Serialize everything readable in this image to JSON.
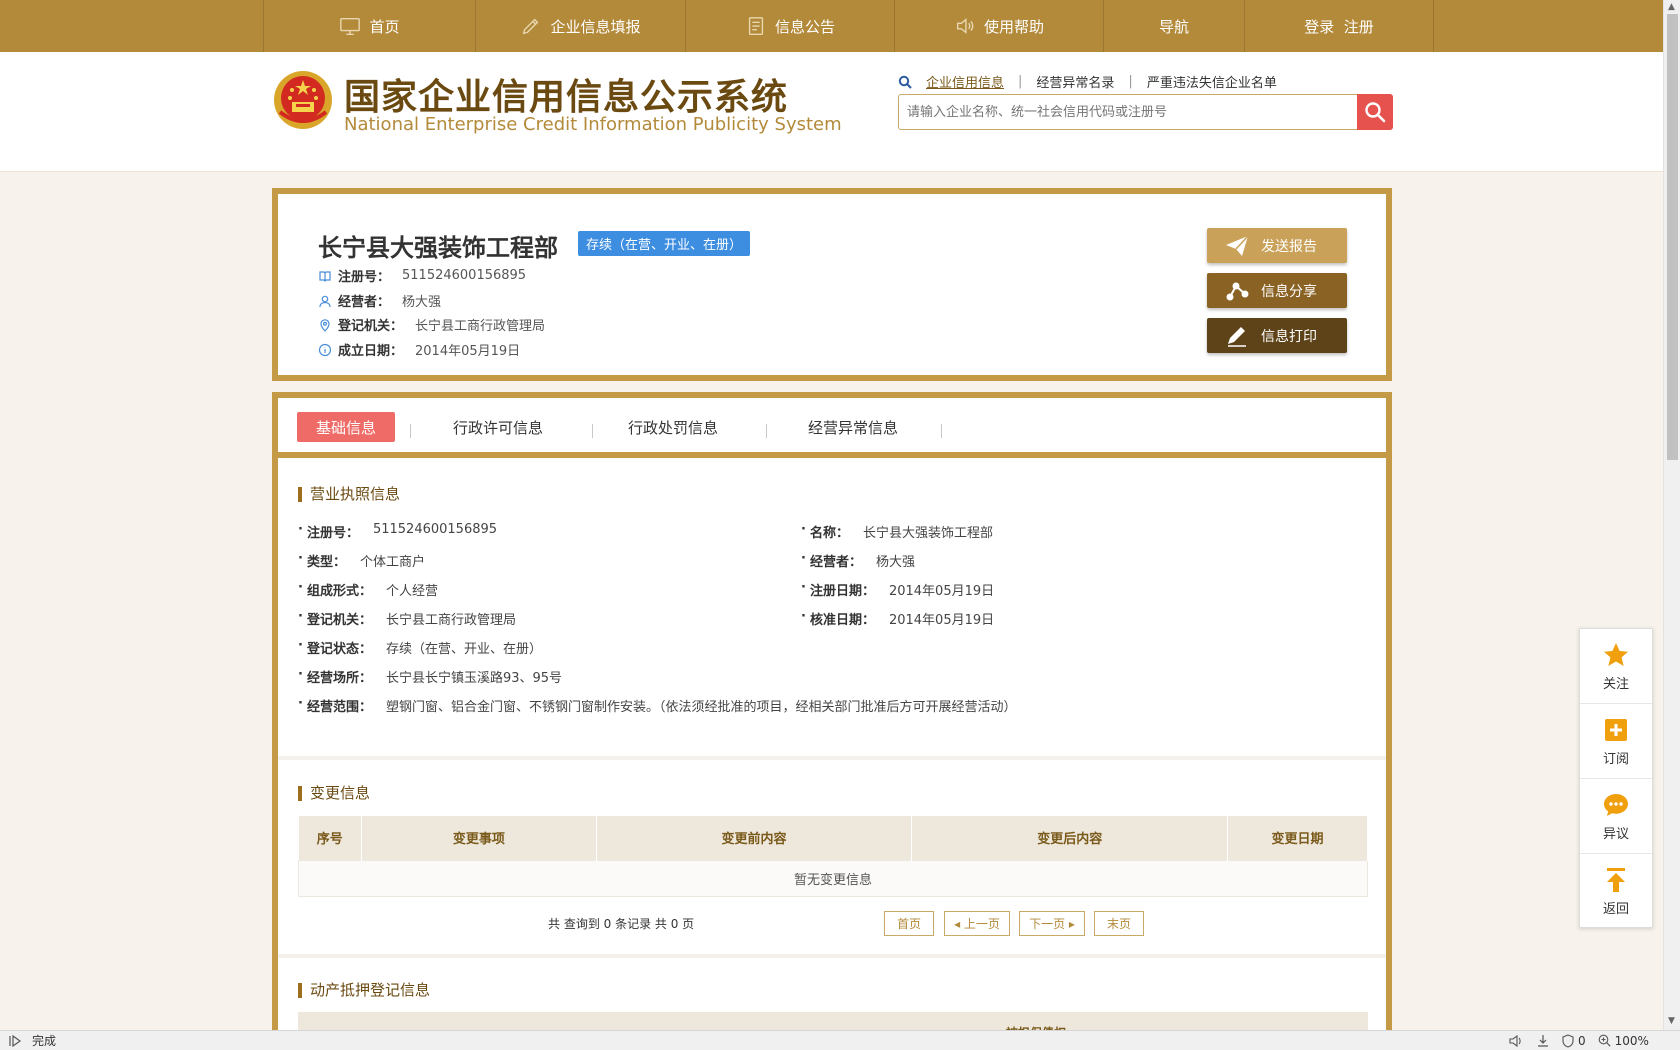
{
  "nav": {
    "items": [
      {
        "label": "首页",
        "icon": "monitor-icon"
      },
      {
        "label": "企业信息填报",
        "icon": "pen-icon"
      },
      {
        "label": "信息公告",
        "icon": "document-icon"
      },
      {
        "label": "使用帮助",
        "icon": "speaker-icon"
      },
      {
        "label": "导航",
        "icon": ""
      },
      {
        "label": "登录  注册",
        "icon": ""
      }
    ]
  },
  "header": {
    "title_cn": "国家企业信用信息公示系统",
    "title_en": "National Enterprise Credit Information Publicity System",
    "search_links": [
      "企业信用信息",
      "经营异常名录",
      "严重违法失信企业名单"
    ],
    "search_placeholder": "请输入企业名称、统一社会信用代码或注册号"
  },
  "company": {
    "name": "长宁县大强装饰工程部",
    "status": "存续（在营、开业、在册）",
    "reg_no_label": "注册号：",
    "reg_no": "511524600156895",
    "operator_label": "经营者：",
    "operator": "杨大强",
    "authority_label": "登记机关：",
    "authority": "长宁县工商行政管理局",
    "founded_label": "成立日期：",
    "founded": "2014年05月19日",
    "actions": [
      "发送报告",
      "信息分享",
      "信息打印"
    ]
  },
  "tabs": [
    "基础信息",
    "行政许可信息",
    "行政处罚信息",
    "经营异常信息"
  ],
  "license": {
    "title": "营业执照信息",
    "left": [
      {
        "label": "注册号：",
        "value": "511524600156895"
      },
      {
        "label": "类型：",
        "value": "个体工商户"
      },
      {
        "label": "组成形式：",
        "value": "个人经营"
      },
      {
        "label": "登记机关：",
        "value": "长宁县工商行政管理局"
      },
      {
        "label": "登记状态：",
        "value": "存续（在营、开业、在册）"
      },
      {
        "label": "经营场所：",
        "value": "长宁县长宁镇玉溪路93、95号"
      },
      {
        "label": "经营范围：",
        "value": "塑钢门窗、铝合金门窗、不锈钢门窗制作安装。（依法须经批准的项目，经相关部门批准后方可开展经营活动）"
      }
    ],
    "right": [
      {
        "label": "名称：",
        "value": "长宁县大强装饰工程部"
      },
      {
        "label": "经营者：",
        "value": "杨大强"
      },
      {
        "label": "注册日期：",
        "value": "2014年05月19日"
      },
      {
        "label": "核准日期：",
        "value": "2014年05月19日"
      }
    ]
  },
  "changes": {
    "title": "变更信息",
    "columns": [
      "序号",
      "变更事项",
      "变更前内容",
      "变更后内容",
      "变更日期"
    ],
    "empty": "暂无变更信息",
    "pager_info": "共 查询到 0 条记录 共 0 页",
    "pager": [
      "首页",
      "◂ 上一页",
      "下一页 ▸",
      "末页"
    ]
  },
  "mortgage": {
    "title": "动产抵押登记信息",
    "partial_header": "被担保债权"
  },
  "side": [
    "关注",
    "订阅",
    "异议",
    "返回"
  ],
  "status": {
    "left": "完成",
    "zoom": "100%",
    "count": "0"
  },
  "colors": {
    "nav_bg": "#b38a3a",
    "border_gold": "#c49a47",
    "status_blue": "#3d8ee1",
    "tab_active": "#ee6b67",
    "btn_send": "#c9a158",
    "btn_share": "#8a6224",
    "btn_print": "#5e4318",
    "side_icon": "#f0a00c"
  }
}
